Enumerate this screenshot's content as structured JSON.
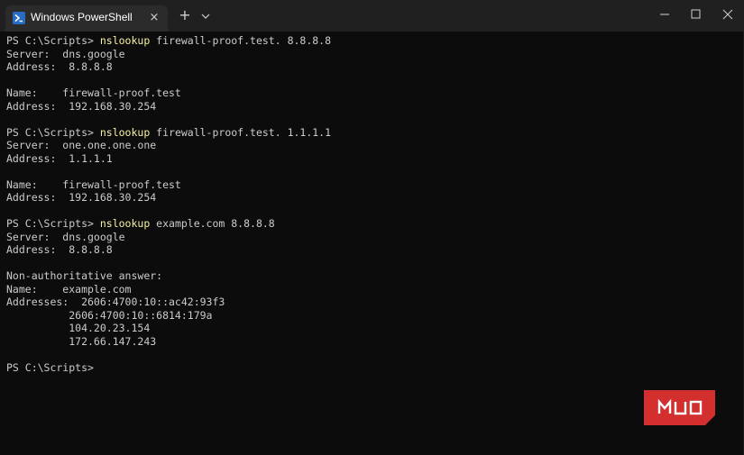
{
  "window": {
    "tab_title": "Windows PowerShell",
    "tab_icon": "powershell-icon",
    "buttons": {
      "close_tab": "×",
      "new_tab": "+",
      "dropdown": "chevron-down-icon",
      "minimize": "minimize-icon",
      "maximize": "maximize-icon",
      "close": "close-icon"
    }
  },
  "terminal": {
    "lines": [
      {
        "prompt": "PS C:\\Scripts> ",
        "cmd": "nslookup",
        "args": " firewall-proof.test. 8.8.8.8"
      },
      {
        "text": "Server:  dns.google"
      },
      {
        "text": "Address:  8.8.8.8"
      },
      {
        "text": ""
      },
      {
        "text": "Name:    firewall-proof.test"
      },
      {
        "text": "Address:  192.168.30.254"
      },
      {
        "text": ""
      },
      {
        "prompt": "PS C:\\Scripts> ",
        "cmd": "nslookup",
        "args": " firewall-proof.test. 1.1.1.1"
      },
      {
        "text": "Server:  one.one.one.one"
      },
      {
        "text": "Address:  1.1.1.1"
      },
      {
        "text": ""
      },
      {
        "text": "Name:    firewall-proof.test"
      },
      {
        "text": "Address:  192.168.30.254"
      },
      {
        "text": ""
      },
      {
        "prompt": "PS C:\\Scripts> ",
        "cmd": "nslookup",
        "args": " example.com 8.8.8.8"
      },
      {
        "text": "Server:  dns.google"
      },
      {
        "text": "Address:  8.8.8.8"
      },
      {
        "text": ""
      },
      {
        "text": "Non-authoritative answer:"
      },
      {
        "text": "Name:    example.com"
      },
      {
        "text": "Addresses:  2606:4700:10::ac42:93f3"
      },
      {
        "text": "          2606:4700:10::6814:179a"
      },
      {
        "text": "          104.20.23.154"
      },
      {
        "text": "          172.66.147.243"
      },
      {
        "text": ""
      },
      {
        "prompt": "PS C:\\Scripts> ",
        "cmd": "",
        "args": ""
      }
    ]
  },
  "watermark": {
    "text": "MUO",
    "color": "#d32f2f"
  },
  "colors": {
    "background": "#0c0c0c",
    "text": "#cccccc",
    "command": "#f9f1a5",
    "titlebar": "#202020",
    "tab": "#2b2b2b"
  }
}
